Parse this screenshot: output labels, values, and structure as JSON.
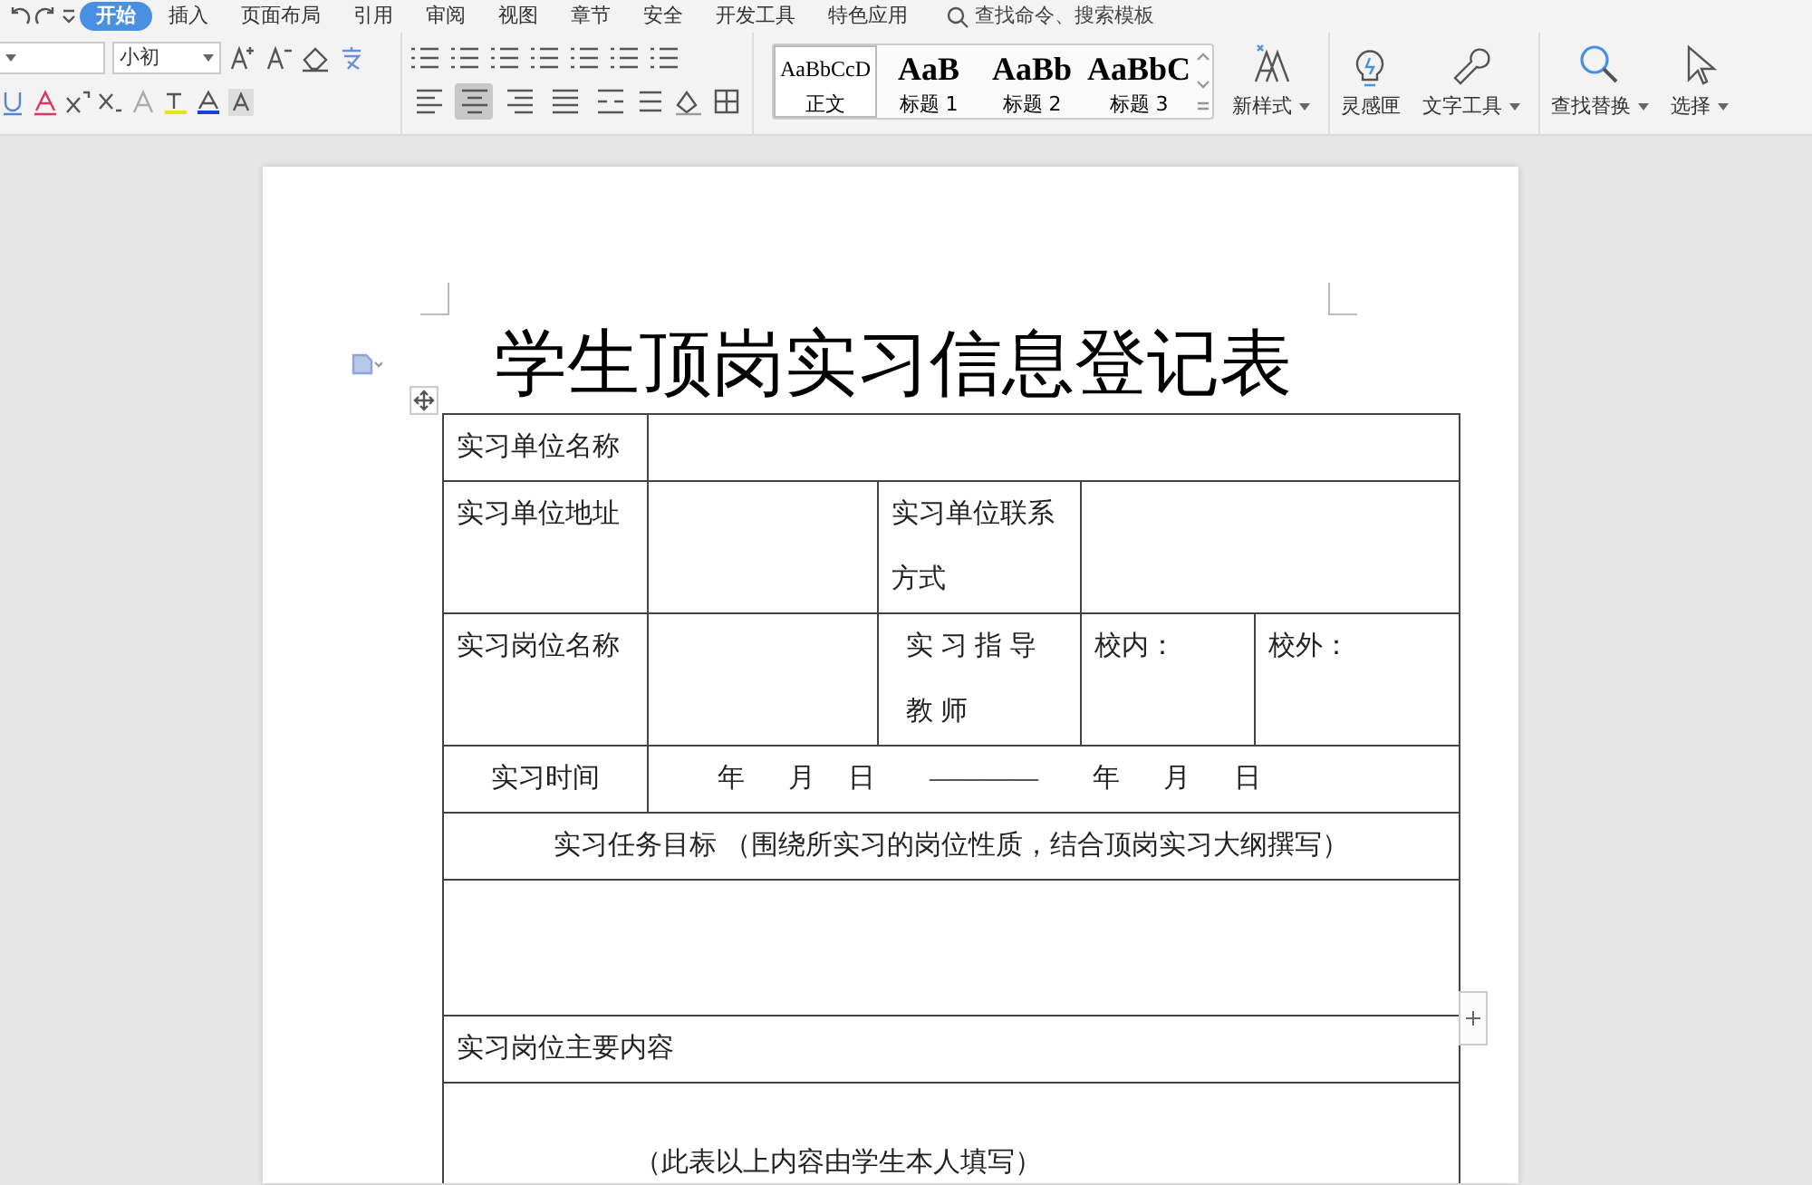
{
  "tabs": [
    {
      "label": "开始",
      "selected": true
    },
    {
      "label": "插入",
      "selected": false
    },
    {
      "label": "页面布局",
      "selected": false
    },
    {
      "label": "引用",
      "selected": false
    },
    {
      "label": "审阅",
      "selected": false
    },
    {
      "label": "视图",
      "selected": false
    },
    {
      "label": "章节",
      "selected": false
    },
    {
      "label": "安全",
      "selected": false
    },
    {
      "label": "开发工具",
      "selected": false
    },
    {
      "label": "特色应用",
      "selected": false
    }
  ],
  "search": {
    "placeholder": "查找命令、搜索模板"
  },
  "font": {
    "size": "小初"
  },
  "paragraph_align": [
    {
      "kind": "left",
      "selected": false
    },
    {
      "kind": "center",
      "selected": true
    },
    {
      "kind": "right",
      "selected": false
    },
    {
      "kind": "justify",
      "selected": false
    },
    {
      "kind": "distributed",
      "selected": false
    }
  ],
  "styles": [
    {
      "preview": "AaBbCcD",
      "label": "正文",
      "selected": true
    },
    {
      "preview": "AaB",
      "label": "标题 1",
      "selected": false
    },
    {
      "preview": "AaBb",
      "label": "标题 2",
      "selected": false
    },
    {
      "preview": "AaBbC",
      "label": "标题 3",
      "selected": false
    }
  ],
  "tools": [
    {
      "kind": "new-style",
      "label": "新样式",
      "dropdown": true
    },
    {
      "kind": "bulb",
      "label": "灵感匣",
      "dropdown": false
    },
    {
      "kind": "wrench",
      "label": "文字工具",
      "dropdown": true
    },
    {
      "kind": "find",
      "label": "查找替换",
      "dropdown": true
    },
    {
      "kind": "cursor",
      "label": "选择",
      "dropdown": true
    }
  ],
  "document": {
    "title": "学生顶岗实习信息登记表",
    "rows": [
      [
        {
          "kind": "label",
          "text": "实习单位名称"
        },
        {
          "kind": "blank",
          "colspan": 4
        }
      ],
      [
        {
          "kind": "label",
          "text": "实习单位地址"
        },
        {
          "kind": "blank"
        },
        {
          "kind": "label",
          "text": "实习单位联系方式"
        },
        {
          "kind": "blank",
          "colspan": 2
        }
      ],
      [
        {
          "kind": "label",
          "text": "实习岗位名称"
        },
        {
          "kind": "blank"
        },
        {
          "kind": "spaced",
          "text": "实习指导教师"
        },
        {
          "kind": "label",
          "text": "校内："
        },
        {
          "kind": "label",
          "text": "校外："
        }
      ],
      [
        {
          "kind": "centered",
          "text": "实习时间"
        },
        {
          "kind": "date",
          "parts": [
            "年",
            "月",
            "日",
            "————",
            "年",
            "月",
            "日"
          ],
          "colspan": 4
        }
      ],
      [
        {
          "kind": "centered",
          "text": "实习任务目标 （围绕所实习的岗位性质，结合顶岗实习大纲撰写）",
          "colspan": 5
        }
      ],
      [
        {
          "kind": "blank",
          "colspan": 5
        }
      ],
      [
        {
          "kind": "label",
          "text": "实习岗位主要内容",
          "colspan": 5
        }
      ],
      [
        {
          "kind": "note",
          "text": "（此表以上内容由学生本人填写）",
          "colspan": 5
        }
      ]
    ]
  }
}
